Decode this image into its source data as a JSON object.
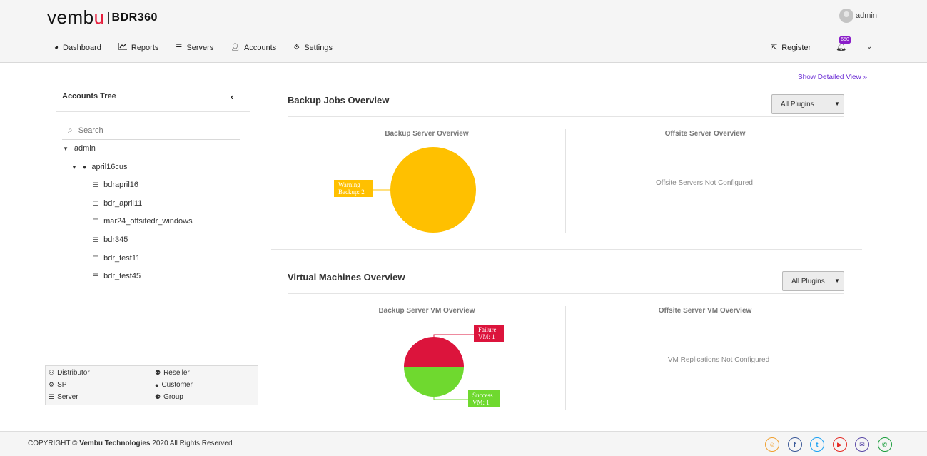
{
  "brand": {
    "logo_prefix": "vemb",
    "logo_u": "u",
    "product": "BDR360"
  },
  "user": {
    "name": "admin"
  },
  "nav": [
    {
      "label": "Dashboard",
      "icon": "dashboard-icon"
    },
    {
      "label": "Reports",
      "icon": "line-chart-icon"
    },
    {
      "label": "Servers",
      "icon": "server-list-icon"
    },
    {
      "label": "Accounts",
      "icon": "user-icon"
    },
    {
      "label": "Settings",
      "icon": "gears-icon"
    }
  ],
  "header_right": {
    "register": "Register",
    "notifications": "650"
  },
  "tree": {
    "title": "Accounts Tree",
    "search_placeholder": "Search",
    "root": "admin",
    "customer": "april16cus",
    "servers": [
      "bdrapril16",
      "bdr_april11",
      "mar24_offsitedr_windows",
      "bdr345",
      "bdr_test11",
      "bdr_test45"
    ]
  },
  "legend": {
    "distributor": "Distributor",
    "reseller": "Reseller",
    "sp": "SP",
    "customer": "Customer",
    "server": "Server",
    "group": "Group"
  },
  "main": {
    "show_detailed": "Show Detailed View",
    "backup": {
      "title": "Backup Jobs Overview",
      "select": "All Plugins",
      "left_title": "Backup Server Overview",
      "right_title": "Offsite Server Overview",
      "right_msg": "Offsite Servers Not Configured",
      "label_warning_1": "Warning",
      "label_warning_2": "Backup: 2"
    },
    "vm": {
      "title": "Virtual Machines Overview",
      "select": "All Plugins",
      "left_title": "Backup Server VM Overview",
      "right_title": "Offsite Server VM Overview",
      "right_msg": "VM Replications Not Configured",
      "label_failure_1": "Failure",
      "label_failure_2": "VM: 1",
      "label_success_1": "Success",
      "label_success_2": "VM: 1"
    }
  },
  "chart_data": [
    {
      "type": "pie",
      "categories": [
        "Warning"
      ],
      "values": [
        2
      ],
      "colors": [
        "#ffc000"
      ]
    },
    {
      "type": "pie",
      "categories": [
        "Failure",
        "Success"
      ],
      "values": [
        1,
        1
      ],
      "colors": [
        "#dc143c",
        "#6fd92f"
      ]
    }
  ],
  "footer": {
    "copyright_prefix": "COPYRIGHT ©",
    "company": "Vembu Technologies",
    "copyright_suffix": "2020 All Rights Reserved",
    "social": [
      {
        "icon": "chat-icon",
        "glyph": "☺",
        "color": "#f0a030"
      },
      {
        "icon": "facebook-icon",
        "glyph": "f",
        "color": "#3b5998"
      },
      {
        "icon": "twitter-icon",
        "glyph": "t",
        "color": "#1da1f2"
      },
      {
        "icon": "youtube-icon",
        "glyph": "▶",
        "color": "#e52d27"
      },
      {
        "icon": "email-icon",
        "glyph": "✉",
        "color": "#5b4aa8"
      },
      {
        "icon": "phone-icon",
        "glyph": "✆",
        "color": "#1a9e3c"
      }
    ]
  }
}
